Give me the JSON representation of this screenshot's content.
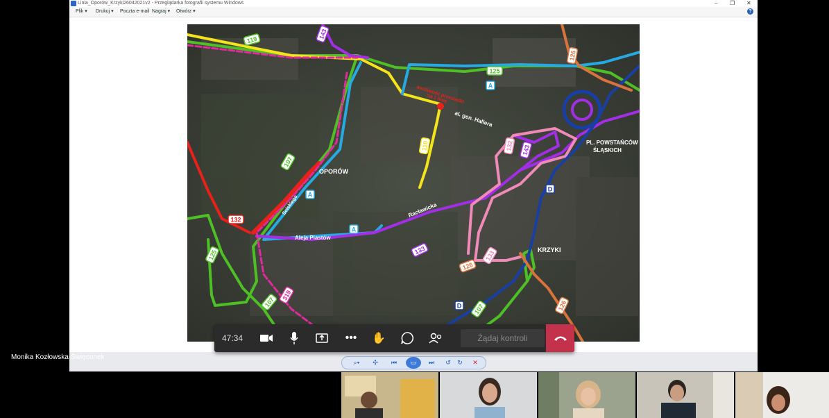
{
  "window": {
    "title": "Linia_Oporów_Krzyki26042021v2 - Przeglądarka fotografii systemu Windows",
    "menu": [
      "Plik",
      "Drukuj",
      "Poczta e-mail",
      "Nagraj",
      "Otwórz"
    ],
    "help_label": "?"
  },
  "map": {
    "place_labels": [
      "OPORÓW",
      "KRZYKI",
      "PL. POWSTAŃCÓW",
      "ŚLĄSKICH"
    ],
    "street_labels": [
      "al. gen. Hallera",
      "Racławicka",
      "Aleja Piastów",
      "Solskiego"
    ],
    "annotation_lines": [
      "możliwość przesiadki",
      "na 1 linię"
    ],
    "route_badges": [
      "119",
      "143",
      "125",
      "126",
      "107",
      "110",
      "132",
      "143",
      "133",
      "125",
      "319",
      "107",
      "126",
      "132",
      "107",
      "126",
      "133"
    ],
    "line_letters": [
      "A",
      "A",
      "A",
      "D",
      "D"
    ],
    "colors": {
      "green": "#4fbf26",
      "yellow": "#f3e41c",
      "blue": "#27a9e1",
      "purple": "#a22ee6",
      "pink": "#f08ab8",
      "red": "#e8211b",
      "magenta": "#e02a9d",
      "navy": "#1a3fa3",
      "salmon": "#d9733d"
    }
  },
  "call": {
    "timer": "47:34",
    "request_control": "Żądaj kontroli",
    "presenter_name": "Monika Kozłowska-Święconek"
  },
  "participants": [
    "",
    "",
    "",
    "",
    ""
  ]
}
